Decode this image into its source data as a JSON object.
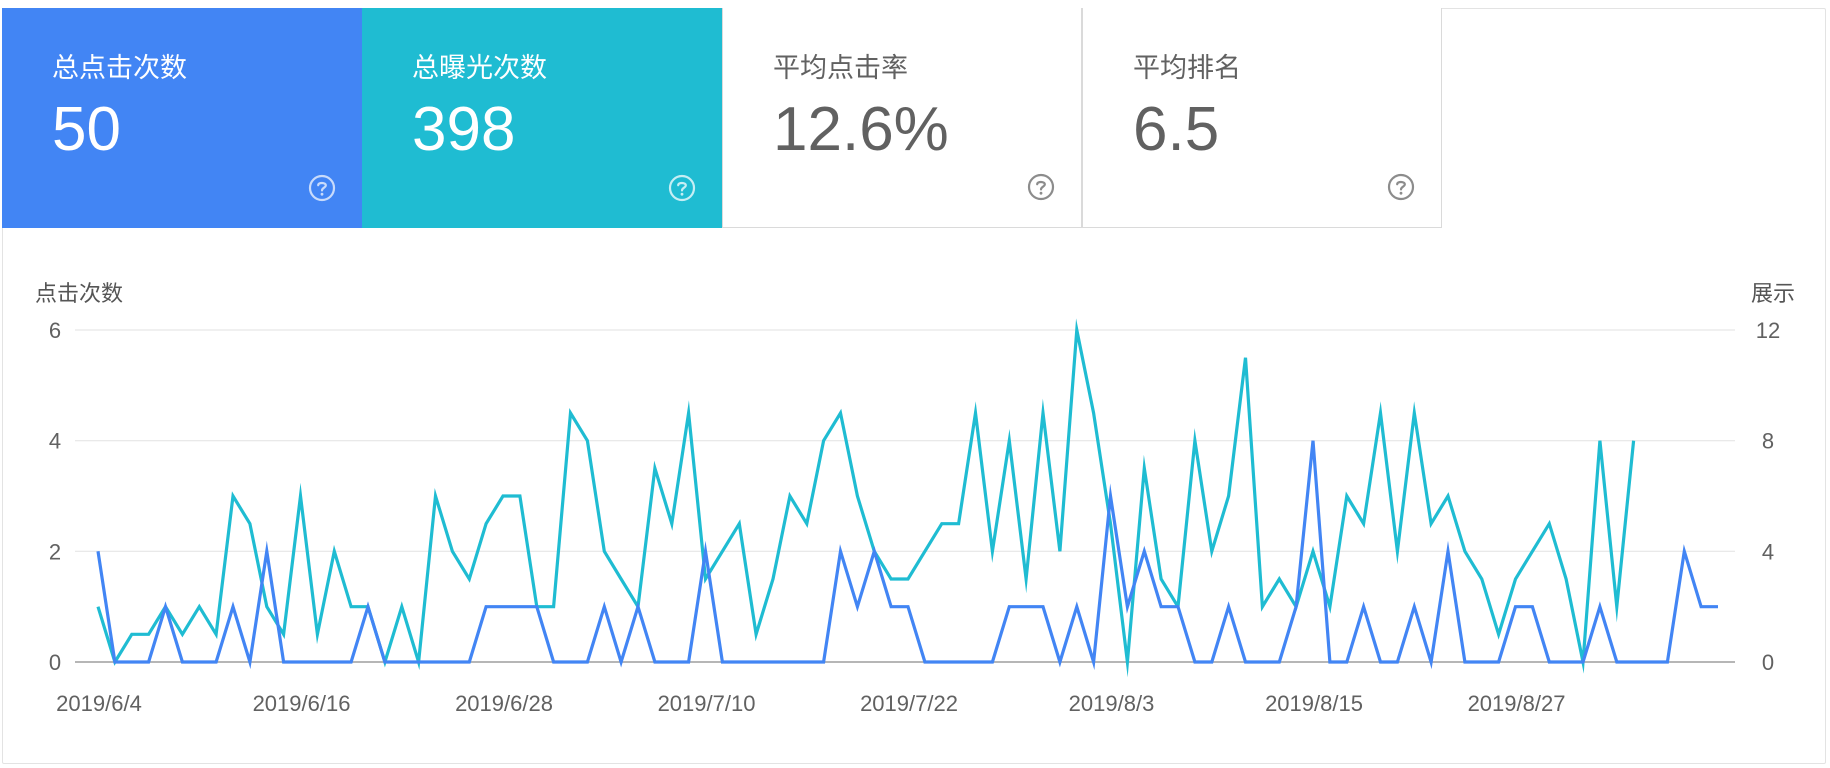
{
  "colors": {
    "clicks": "#4285f4",
    "impressions": "#1fbcd2",
    "grid": "#e6e6e6",
    "axis_text": "#616161",
    "card_text_light": "#616161"
  },
  "cards": [
    {
      "label": "总点击次数",
      "value": "50",
      "icon": "help-circle-icon"
    },
    {
      "label": "总曝光次数",
      "value": "398",
      "icon": "help-circle-icon"
    },
    {
      "label": "平均点击率",
      "value": "12.6%",
      "icon": "help-circle-icon"
    },
    {
      "label": "平均排名",
      "value": "6.5",
      "icon": "help-circle-icon"
    }
  ],
  "chart_data": {
    "type": "line",
    "ylabel_left": "点击次数",
    "ylabel_right": "展示",
    "ylim_left": [
      0,
      6
    ],
    "ylim_right": [
      0,
      12
    ],
    "yticks_left": [
      0,
      2,
      4,
      6
    ],
    "yticks_right": [
      0,
      4,
      8,
      12
    ],
    "grid": true,
    "x_start": "2019/6/4",
    "x_tick_labels": [
      "2019/6/4",
      "2019/6/16",
      "2019/6/28",
      "2019/7/10",
      "2019/7/22",
      "2019/8/3",
      "2019/8/15",
      "2019/8/27"
    ],
    "x_tick_day_index": [
      0,
      12,
      24,
      36,
      48,
      60,
      72,
      84
    ],
    "series": [
      {
        "name": "点击次数",
        "axis": "left",
        "values": [
          2,
          0,
          0,
          0,
          1,
          0,
          0,
          0,
          1,
          0,
          2,
          0,
          0,
          0,
          0,
          0,
          1,
          0,
          0,
          0,
          0,
          0,
          0,
          1,
          1,
          1,
          1,
          0,
          0,
          0,
          1,
          0,
          1,
          0,
          0,
          0,
          2,
          0,
          0,
          0,
          0,
          0,
          0,
          0,
          2,
          1,
          2,
          1,
          1,
          0,
          0,
          0,
          0,
          0,
          1,
          1,
          1,
          0,
          1,
          0,
          3,
          1,
          2,
          1,
          1,
          0,
          0,
          1,
          0,
          0,
          0,
          1,
          4,
          0,
          0,
          1,
          0,
          0,
          1,
          0,
          2,
          0,
          0,
          0,
          1,
          1,
          0,
          0,
          0,
          1,
          0,
          0,
          0,
          0,
          2,
          1,
          1
        ]
      },
      {
        "name": "展示",
        "axis": "right",
        "values": [
          2,
          0,
          1,
          1,
          2,
          1,
          2,
          1,
          6,
          5,
          2,
          1,
          6,
          1,
          4,
          2,
          2,
          0,
          2,
          0,
          6,
          4,
          3,
          5,
          6,
          6,
          2,
          2,
          9,
          8,
          4,
          3,
          2,
          7,
          5,
          9,
          3,
          4,
          5,
          1,
          3,
          6,
          5,
          8,
          9,
          6,
          4,
          3,
          3,
          4,
          5,
          5,
          9,
          4,
          8,
          3,
          9,
          4,
          12,
          9,
          5,
          0,
          7,
          3,
          2,
          8,
          4,
          6,
          11,
          2,
          3,
          2,
          4,
          2,
          6,
          5,
          9,
          4,
          9,
          5,
          6,
          4,
          3,
          1,
          3,
          4,
          5,
          3,
          0,
          8,
          2,
          8
        ]
      }
    ]
  }
}
